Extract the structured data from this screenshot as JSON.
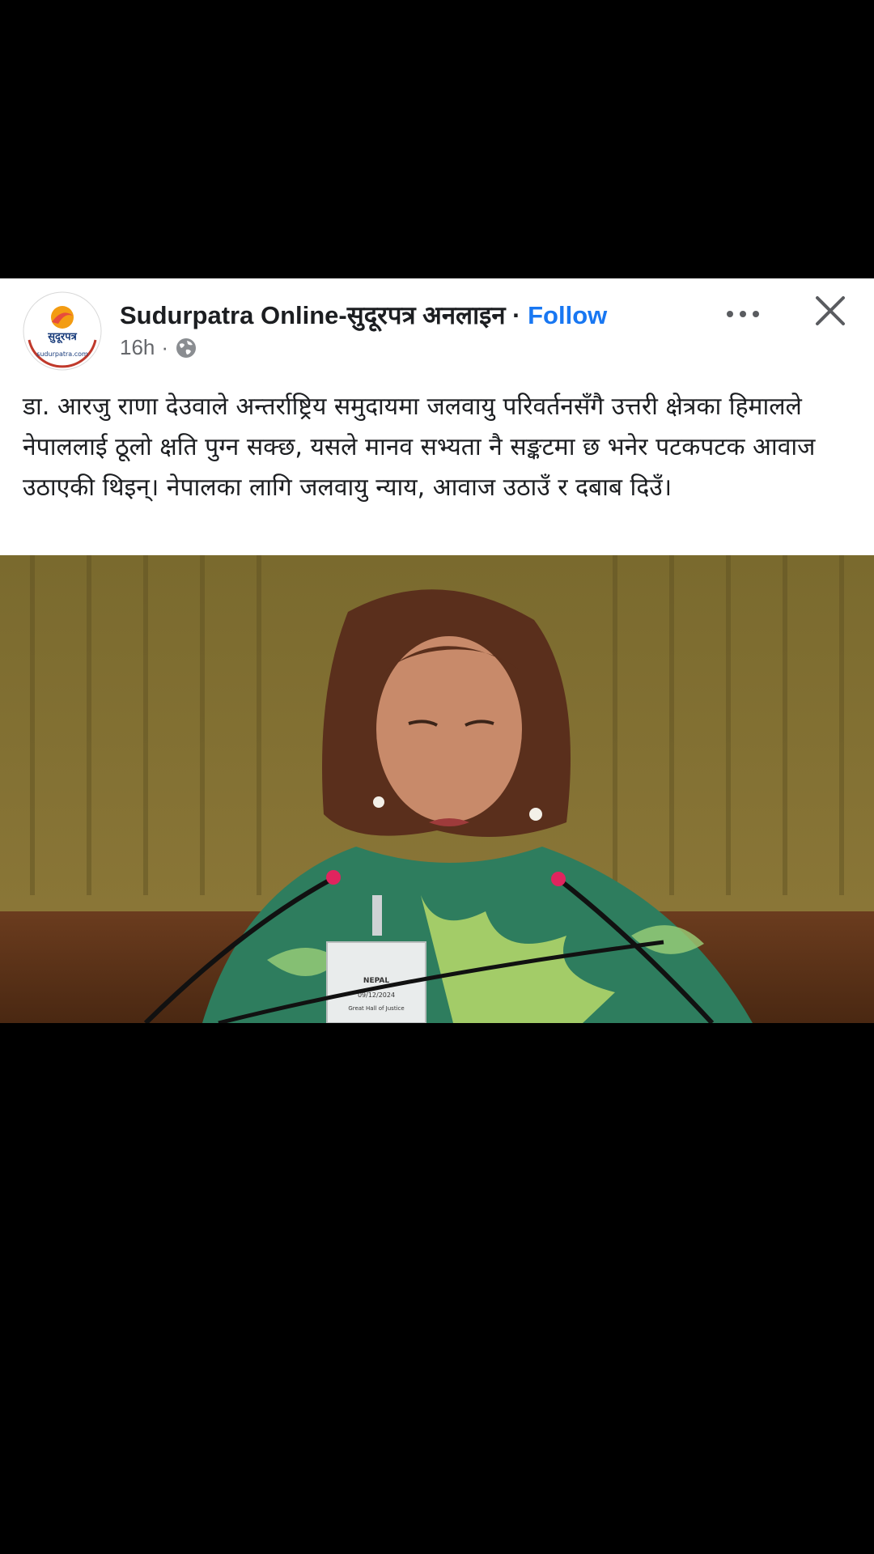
{
  "post": {
    "page_name": "Sudurpatra Online-सुदूरपत्र अनलाइन",
    "separator": "·",
    "follow_label": "Follow",
    "time": "16h",
    "meta_separator": "·",
    "audience_icon": "globe-icon",
    "avatar": {
      "logo_text": "सुदूरपत्र",
      "logo_subtext": "sudurpatra.com"
    },
    "caption": "डा. आरजु राणा देउवाले अन्तर्राष्ट्रिय समुदायमा जलवायु परिवर्तनसँगै उत्तरी क्षेत्रका हिमालले नेपाललाई ठूलो क्षति पुग्न सक्छ, यसले मानव सभ्यता नै सङ्कटमा छ भनेर पटकपटक आवाज उठाएकी थिइन्। नेपालका लागि जलवायु न्याय, आवाज उठाउँ र दबाब दिउँ।"
  },
  "toolbar": {
    "more_icon": "more-options-icon",
    "close_icon": "close-icon"
  },
  "video": {
    "nameplate_text": "NEPAL",
    "nameplate_date": "09/12/2024",
    "nameplate_venue": "Great Hall of Justice"
  },
  "colors": {
    "follow": "#1877f2",
    "text": "#1c1e21",
    "muted": "#65676b",
    "background": "#000000"
  }
}
